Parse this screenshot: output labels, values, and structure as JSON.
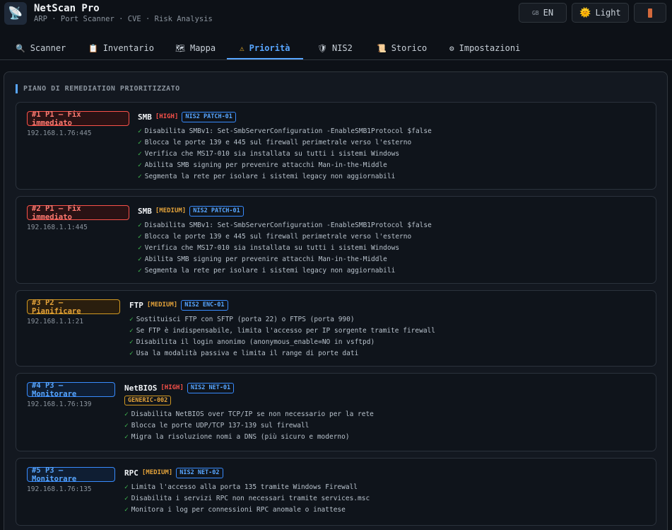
{
  "app": {
    "title": "NetScan Pro",
    "subtitle": "ARP · Port Scanner · CVE · Risk Analysis",
    "logo_icon": "satellite-dish-icon"
  },
  "header": {
    "lang_flag": "GB",
    "lang_label": "EN",
    "theme_label": "Light",
    "theme_icon": "sun-icon"
  },
  "tabs": [
    {
      "label": "Scanner",
      "icon": "🔍",
      "active": false
    },
    {
      "label": "Inventario",
      "icon": "📋",
      "active": false
    },
    {
      "label": "Mappa",
      "icon": "🗺",
      "active": false
    },
    {
      "label": "Priorità",
      "icon": "⚠",
      "active": true
    },
    {
      "label": "NIS2",
      "icon": "🛡",
      "active": false
    },
    {
      "label": "Storico",
      "icon": "📜",
      "active": false
    },
    {
      "label": "Impostazioni",
      "icon": "⚙",
      "active": false
    }
  ],
  "section_title": "PIANO DI REMEDIATION PRIORITIZZATO",
  "colors": {
    "accent": "#58a6ff",
    "p1": "#f85149",
    "p2": "#d29922",
    "p3": "#388bfd",
    "check": "#3fb950"
  },
  "cards": [
    {
      "priority": "#1 P1 — Fix immediato",
      "level": "p1",
      "ip": "192.168.1.76:445",
      "service": "SMB",
      "severity": "[HIGH]",
      "severity_level": "high",
      "nis_tag": "NIS2 PATCH-01",
      "generic_tag": "",
      "steps": [
        "Disabilita SMBv1: Set-SmbServerConfiguration -EnableSMB1Protocol $false",
        "Blocca le porte 139 e 445 sul firewall perimetrale verso l'esterno",
        "Verifica che MS17-010 sia installata su tutti i sistemi Windows",
        "Abilita SMB signing per prevenire attacchi Man-in-the-Middle",
        "Segmenta la rete per isolare i sistemi legacy non aggiornabili"
      ]
    },
    {
      "priority": "#2 P1 — Fix immediato",
      "level": "p1",
      "ip": "192.168.1.1:445",
      "service": "SMB",
      "severity": "[MEDIUM]",
      "severity_level": "medium",
      "nis_tag": "NIS2 PATCH-01",
      "generic_tag": "",
      "steps": [
        "Disabilita SMBv1: Set-SmbServerConfiguration -EnableSMB1Protocol $false",
        "Blocca le porte 139 e 445 sul firewall perimetrale verso l'esterno",
        "Verifica che MS17-010 sia installata su tutti i sistemi Windows",
        "Abilita SMB signing per prevenire attacchi Man-in-the-Middle",
        "Segmenta la rete per isolare i sistemi legacy non aggiornabili"
      ]
    },
    {
      "priority": "#3 P2 — Pianificare",
      "level": "p2",
      "ip": "192.168.1.1:21",
      "service": "FTP",
      "severity": "[MEDIUM]",
      "severity_level": "medium",
      "nis_tag": "NIS2 ENC-01",
      "generic_tag": "",
      "steps": [
        "Sostituisci FTP con SFTP (porta 22) o FTPS (porta 990)",
        "Se FTP è indispensabile, limita l'accesso per IP sorgente tramite firewall",
        "Disabilita il login anonimo (anonymous_enable=NO in vsftpd)",
        "Usa la modalità passiva e limita il range di porte dati"
      ]
    },
    {
      "priority": "#4 P3 — Monitorare",
      "level": "p3",
      "ip": "192.168.1.76:139",
      "service": "NetBIOS",
      "severity": "[HIGH]",
      "severity_level": "high",
      "nis_tag": "NIS2 NET-01",
      "generic_tag": "GENERIC-002",
      "steps": [
        "Disabilita NetBIOS over TCP/IP se non necessario per la rete",
        "Blocca le porte UDP/TCP 137-139 sul firewall",
        "Migra la risoluzione nomi a DNS (più sicuro e moderno)"
      ]
    },
    {
      "priority": "#5 P3 — Monitorare",
      "level": "p3",
      "ip": "192.168.1.76:135",
      "service": "RPC",
      "severity": "[MEDIUM]",
      "severity_level": "medium",
      "nis_tag": "NIS2 NET-02",
      "generic_tag": "",
      "steps": [
        "Limita l'accesso alla porta 135 tramite Windows Firewall",
        "Disabilita i servizi RPC non necessari tramite services.msc",
        "Monitora i log per connessioni RPC anomale o inattese"
      ]
    }
  ]
}
